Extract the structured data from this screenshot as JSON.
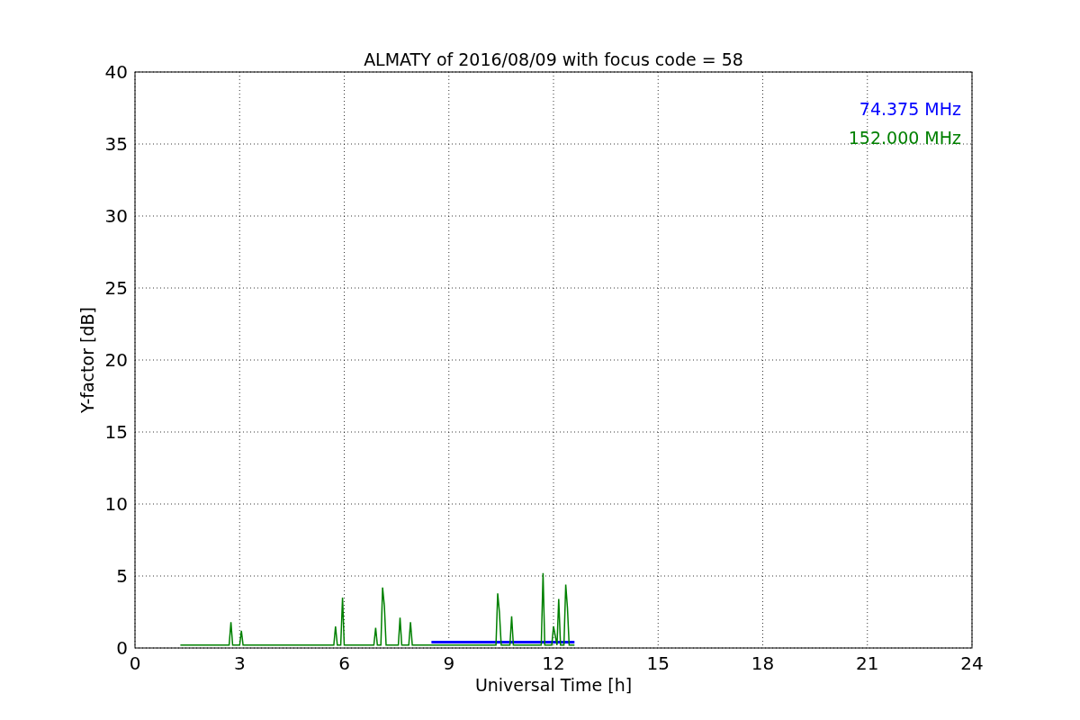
{
  "figure": {
    "chart_data": {
      "type": "line",
      "title": "ALMATY of 2016/08/09 with focus code = 58",
      "xlabel": "Universal Time [h]",
      "ylabel": "Y-factor [dB]",
      "xlim": [
        0,
        24
      ],
      "ylim": [
        0,
        40
      ],
      "xticks": [
        0,
        3,
        6,
        9,
        12,
        15,
        18,
        21,
        24
      ],
      "yticks": [
        0,
        5,
        10,
        15,
        20,
        25,
        30,
        35,
        40
      ],
      "grid": true,
      "series": [
        {
          "name": "74.375 MHz",
          "color": "#0000ff",
          "x": [
            8.5,
            9.5,
            10.5,
            11.5,
            12.6
          ],
          "values": [
            0.4,
            0.4,
            0.4,
            0.4,
            0.4
          ]
        },
        {
          "name": "152.000 MHz",
          "color": "#008000",
          "x": [
            1.3,
            2.7,
            2.75,
            2.8,
            3.0,
            3.05,
            3.1,
            5.7,
            5.75,
            5.8,
            5.9,
            5.95,
            6.0,
            6.85,
            6.9,
            6.95,
            7.05,
            7.1,
            7.15,
            7.2,
            7.55,
            7.6,
            7.65,
            7.85,
            7.9,
            7.95,
            10.35,
            10.4,
            10.45,
            10.5,
            10.75,
            10.8,
            10.85,
            11.65,
            11.7,
            11.75,
            11.95,
            12.0,
            12.1,
            12.15,
            12.2,
            12.3,
            12.35,
            12.4,
            12.45,
            12.6
          ],
          "values": [
            0.2,
            0.2,
            1.8,
            0.2,
            0.2,
            1.2,
            0.2,
            0.2,
            1.5,
            0.2,
            0.2,
            3.5,
            0.2,
            0.2,
            1.4,
            0.2,
            0.2,
            4.2,
            2.9,
            0.2,
            0.2,
            2.1,
            0.2,
            0.2,
            1.8,
            0.2,
            0.2,
            3.8,
            2.5,
            0.2,
            0.2,
            2.2,
            0.2,
            0.2,
            5.2,
            0.2,
            0.2,
            1.5,
            0.2,
            3.4,
            0.2,
            0.2,
            4.4,
            2.8,
            0.2,
            0.2
          ]
        }
      ]
    }
  }
}
